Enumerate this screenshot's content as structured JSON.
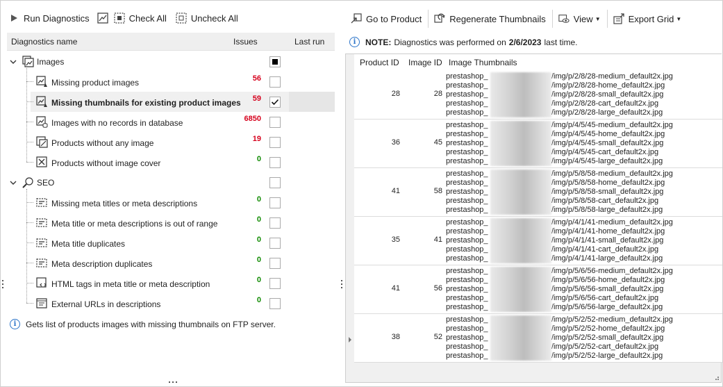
{
  "left_toolbar": {
    "run_diagnostics": "Run Diagnostics",
    "check_all": "Check All",
    "uncheck_all": "Uncheck All"
  },
  "diagnostics_grid": {
    "columns": [
      "Diagnostics name",
      "Issues",
      "Last run"
    ],
    "groups": [
      {
        "label": "Images",
        "icon": "images-icon",
        "checkbox": "partial",
        "items": [
          {
            "label": "Missing product images",
            "issues": "56",
            "status": "red",
            "checked": false,
            "icon": "image-warning-icon"
          },
          {
            "label": "Missing thumbnails for existing product images",
            "issues": "59",
            "status": "red",
            "checked": true,
            "selected": true,
            "icon": "image-warning-icon"
          },
          {
            "label": "Images with no records in database",
            "issues": "6850",
            "status": "red",
            "checked": false,
            "icon": "image-database-icon"
          },
          {
            "label": "Products without any image",
            "issues": "19",
            "status": "red",
            "checked": false,
            "icon": "image-missing-icon"
          },
          {
            "label": "Products without image cover",
            "issues": "0",
            "status": "green",
            "checked": false,
            "icon": "image-cover-icon"
          }
        ]
      },
      {
        "label": "SEO",
        "icon": "search-icon",
        "checkbox": "unchecked",
        "items": [
          {
            "label": "Missing meta titles or meta descriptions",
            "issues": "0",
            "status": "green",
            "checked": false,
            "icon": "meta-missing-icon"
          },
          {
            "label": "Meta title or meta descriptions is out of range",
            "issues": "0",
            "status": "green",
            "checked": false,
            "icon": "meta-range-icon"
          },
          {
            "label": "Meta title duplicates",
            "issues": "0",
            "status": "green",
            "checked": false,
            "icon": "meta-title-duplicate-icon"
          },
          {
            "label": "Meta description duplicates",
            "issues": "0",
            "status": "green",
            "checked": false,
            "icon": "meta-description-duplicate-icon"
          },
          {
            "label": "HTML tags in meta title or meta description",
            "issues": "0",
            "status": "green",
            "checked": false,
            "icon": "html-tags-icon"
          },
          {
            "label": "External URLs in descriptions",
            "issues": "0",
            "status": "green",
            "checked": false,
            "icon": "external-url-icon"
          }
        ]
      }
    ]
  },
  "hint": "Gets list of products images with missing thumbnails on FTP server.",
  "right_toolbar": {
    "go_to_product": "Go to Product",
    "regenerate_thumbnails": "Regenerate Thumbnails",
    "view": "View",
    "export_grid": "Export Grid"
  },
  "note": {
    "label": "NOTE:",
    "text_before": "Diagnostics was performed on",
    "date": "2/6/2023",
    "text_after": "last time."
  },
  "results_grid": {
    "columns": [
      "Product ID",
      "Image ID",
      "Image Thumbnails"
    ],
    "rows": [
      {
        "product_id": "28",
        "image_id": "28",
        "prefix": "prestashop_",
        "thumbs": [
          "/img/p/2/8/28-medium_default2x.jpg",
          "/img/p/2/8/28-home_default2x.jpg",
          "/img/p/2/8/28-small_default2x.jpg",
          "/img/p/2/8/28-cart_default2x.jpg",
          "/img/p/2/8/28-large_default2x.jpg"
        ]
      },
      {
        "product_id": "36",
        "image_id": "45",
        "prefix": "prestashop_",
        "thumbs": [
          "/img/p/4/5/45-medium_default2x.jpg",
          "/img/p/4/5/45-home_default2x.jpg",
          "/img/p/4/5/45-small_default2x.jpg",
          "/img/p/4/5/45-cart_default2x.jpg",
          "/img/p/4/5/45-large_default2x.jpg"
        ]
      },
      {
        "product_id": "41",
        "image_id": "58",
        "prefix": "prestashop_",
        "thumbs": [
          "/img/p/5/8/58-medium_default2x.jpg",
          "/img/p/5/8/58-home_default2x.jpg",
          "/img/p/5/8/58-small_default2x.jpg",
          "/img/p/5/8/58-cart_default2x.jpg",
          "/img/p/5/8/58-large_default2x.jpg"
        ]
      },
      {
        "product_id": "35",
        "image_id": "41",
        "prefix": "prestashop_",
        "thumbs": [
          "/img/p/4/1/41-medium_default2x.jpg",
          "/img/p/4/1/41-home_default2x.jpg",
          "/img/p/4/1/41-small_default2x.jpg",
          "/img/p/4/1/41-cart_default2x.jpg",
          "/img/p/4/1/41-large_default2x.jpg"
        ]
      },
      {
        "product_id": "41",
        "image_id": "56",
        "prefix": "prestashop_",
        "thumbs": [
          "/img/p/5/6/56-medium_default2x.jpg",
          "/img/p/5/6/56-home_default2x.jpg",
          "/img/p/5/6/56-small_default2x.jpg",
          "/img/p/5/6/56-cart_default2x.jpg",
          "/img/p/5/6/56-large_default2x.jpg"
        ]
      },
      {
        "product_id": "38",
        "image_id": "52",
        "prefix": "prestashop_",
        "thumbs": [
          "/img/p/5/2/52-medium_default2x.jpg",
          "/img/p/5/2/52-home_default2x.jpg",
          "/img/p/5/2/52-small_default2x.jpg",
          "/img/p/5/2/52-cart_default2x.jpg",
          "/img/p/5/2/52-large_default2x.jpg"
        ]
      }
    ]
  },
  "colors": {
    "issue_red": "#d6001c",
    "issue_green": "#0f8a00",
    "info_blue": "#2a73c8",
    "header_bg": "#efefef",
    "selected_row_bg": "#f0f0f0"
  }
}
